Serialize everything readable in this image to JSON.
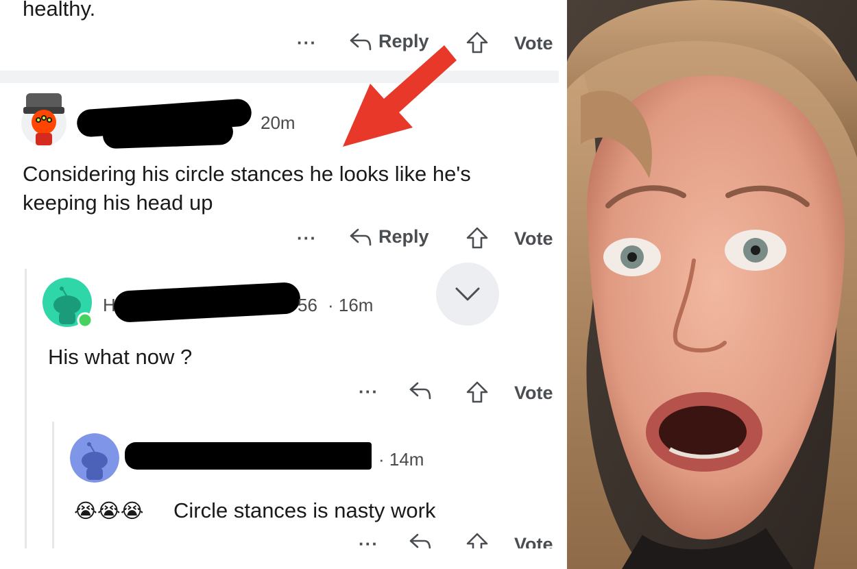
{
  "post": {
    "truncated_text": "healthy.",
    "actions": {
      "more": "···",
      "reply": "Reply",
      "vote": "Vote"
    }
  },
  "comments": [
    {
      "time": "20m",
      "text_line1": "Considering his circle stances he looks like he's",
      "text_line2": "keeping his head up",
      "actions": {
        "more": "···",
        "reply": "Reply",
        "vote": "Vote"
      }
    },
    {
      "user_fragment_start": "H",
      "user_fragment_end": "56",
      "time": "· 16m",
      "text": "His what now ?",
      "actions": {
        "more": "···",
        "vote": "Vote"
      }
    },
    {
      "time": "· 14m",
      "emojis": "😭😭😭",
      "text": "Circle stances is nasty work",
      "actions": {
        "more": "···",
        "vote": "Vote"
      }
    }
  ],
  "colors": {
    "annotation_arrow": "#e8382a",
    "avatar_teal": "#2ed6a8",
    "avatar_blue": "#7f96e8",
    "online_dot": "#46d160"
  }
}
